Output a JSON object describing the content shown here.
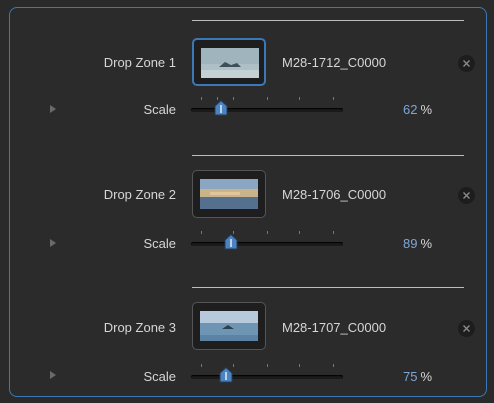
{
  "zones": [
    {
      "label": "Drop Zone 1",
      "clip_name": "M28-1712_C0000",
      "scale_label": "Scale",
      "scale_value": 62,
      "scale_value_text": "62",
      "scale_unit": "%",
      "selected": true
    },
    {
      "label": "Drop Zone 2",
      "clip_name": "M28-1706_C0000",
      "scale_label": "Scale",
      "scale_value": 89,
      "scale_value_text": "89",
      "scale_unit": "%",
      "selected": false
    },
    {
      "label": "Drop Zone 3",
      "clip_name": "M28-1707_C0000",
      "scale_label": "Scale",
      "scale_value": 75,
      "scale_value_text": "75",
      "scale_unit": "%",
      "selected": false
    }
  ],
  "colors": {
    "accent": "#3b78b8",
    "value_text": "#7ea6d4",
    "label_text": "#d6d6d6",
    "background": "#2b2b2b"
  },
  "icons": {
    "remove": "x-circle-icon",
    "disclosure": "disclosure-triangle-icon",
    "thumb": "slider-thumb-icon"
  }
}
